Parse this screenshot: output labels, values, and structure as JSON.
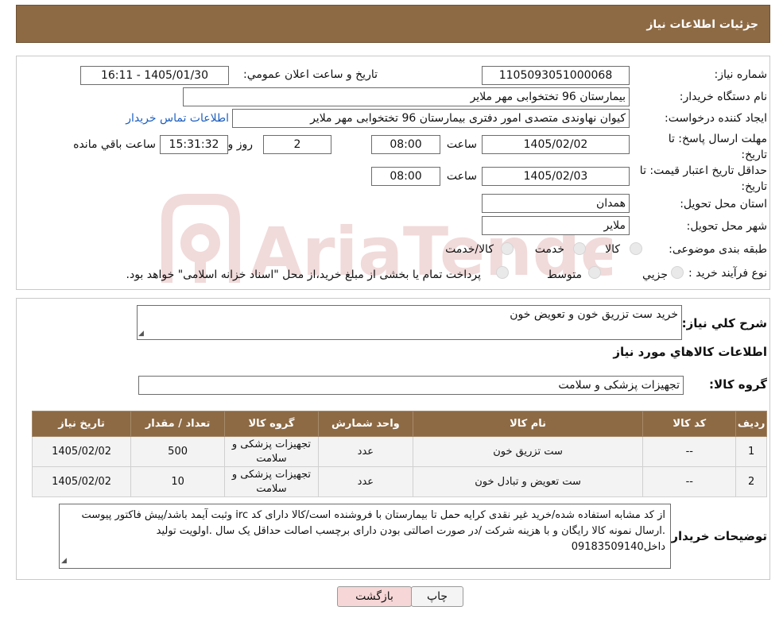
{
  "header": {
    "title": "جزئیات اطلاعات نیاز"
  },
  "form": {
    "need_number_label": "شماره نیاز:",
    "need_number": "1105093051000068",
    "announce_label": "تاریخ و ساعت اعلان عمومي:",
    "announce_value": "1405/01/30 - 16:11",
    "buyer_org_label": "نام دستگاه خریدار:",
    "buyer_org": "بیمارستان 96 تختخوابی مهر ملایر",
    "creator_label": "ایجاد کننده درخواست:",
    "creator": "کیوان نهاوندی متصدی امور دفتری بیمارستان 96 تختخوابی مهر ملایر",
    "contact_link": "اطلاعات تماس خریدار",
    "deadline_label": "مهلت ارسال پاسخ: تا تاریخ:",
    "deadline_date": "1405/02/02",
    "time_label": "ساعت",
    "deadline_time": "08:00",
    "days_value": "2",
    "days_label": "روز و",
    "remaining_time": "15:31:32",
    "remaining_label": "ساعت باقي مانده",
    "validity_label": "حداقل تاریخ اعتبار قیمت: تا تاریخ:",
    "validity_date": "1405/02/03",
    "validity_time": "08:00",
    "province_label": "استان محل تحویل:",
    "province": "همدان",
    "city_label": "شهر محل تحویل:",
    "city": "ملایر",
    "category_label": "طبقه بندی موضوعی:",
    "category_options": [
      "کالا",
      "خدمت",
      "کالا/خدمت"
    ],
    "process_label": "نوع فرآیند خرید :",
    "process_options": [
      "جزیي",
      "متوسط"
    ],
    "process_note": "پرداخت تمام یا بخشی از مبلغ خرید،از محل \"اسناد خزانه اسلامی\" خواهد بود."
  },
  "summary": {
    "desc_label": "شرح کلي نیاز:",
    "desc_value": "خرید ست تزریق خون و تعویض خون",
    "goods_info_title": "اطلاعات کالاهاي مورد نیاز",
    "group_label": "گروه کالا:",
    "group_value": "تجهیزات پزشکی و سلامت"
  },
  "table": {
    "headers": [
      "ردیف",
      "کد کالا",
      "نام کالا",
      "واحد شمارش",
      "گروه کالا",
      "تعداد / مقدار",
      "تاریخ نیاز"
    ],
    "rows": [
      [
        "1",
        "--",
        "ست تزریق خون",
        "عدد",
        "تجهیزات پزشکی و سلامت",
        "500",
        "1405/02/02"
      ],
      [
        "2",
        "--",
        "ست تعویض و تبادل خون",
        "عدد",
        "تجهیزات پزشکی و سلامت",
        "10",
        "1405/02/02"
      ]
    ]
  },
  "notes": {
    "label": "توضیحات خریدار:",
    "text": "از کد مشابه استفاده شده/خرید غیر نقدی کرایه حمل تا بیمارستان با فروشنده است/کالا دارای کد irc  وثبت آیمد باشد/پیش فاکتور پیوست .ارسال نمونه کالا رایگان و با هزینه شرکت /در صورت اصالتی بودن دارای برچسب اصالت حداقل یک سال .اولویت تولید داخل09183509140"
  },
  "buttons": {
    "print": "چاپ",
    "back": "بازگشت"
  },
  "watermark_text": "AriaTender.neT",
  "colors": {
    "header_bg": "#8d6a44",
    "back_button_bg": "#f6d6d6",
    "link": "#1d5fbf"
  }
}
